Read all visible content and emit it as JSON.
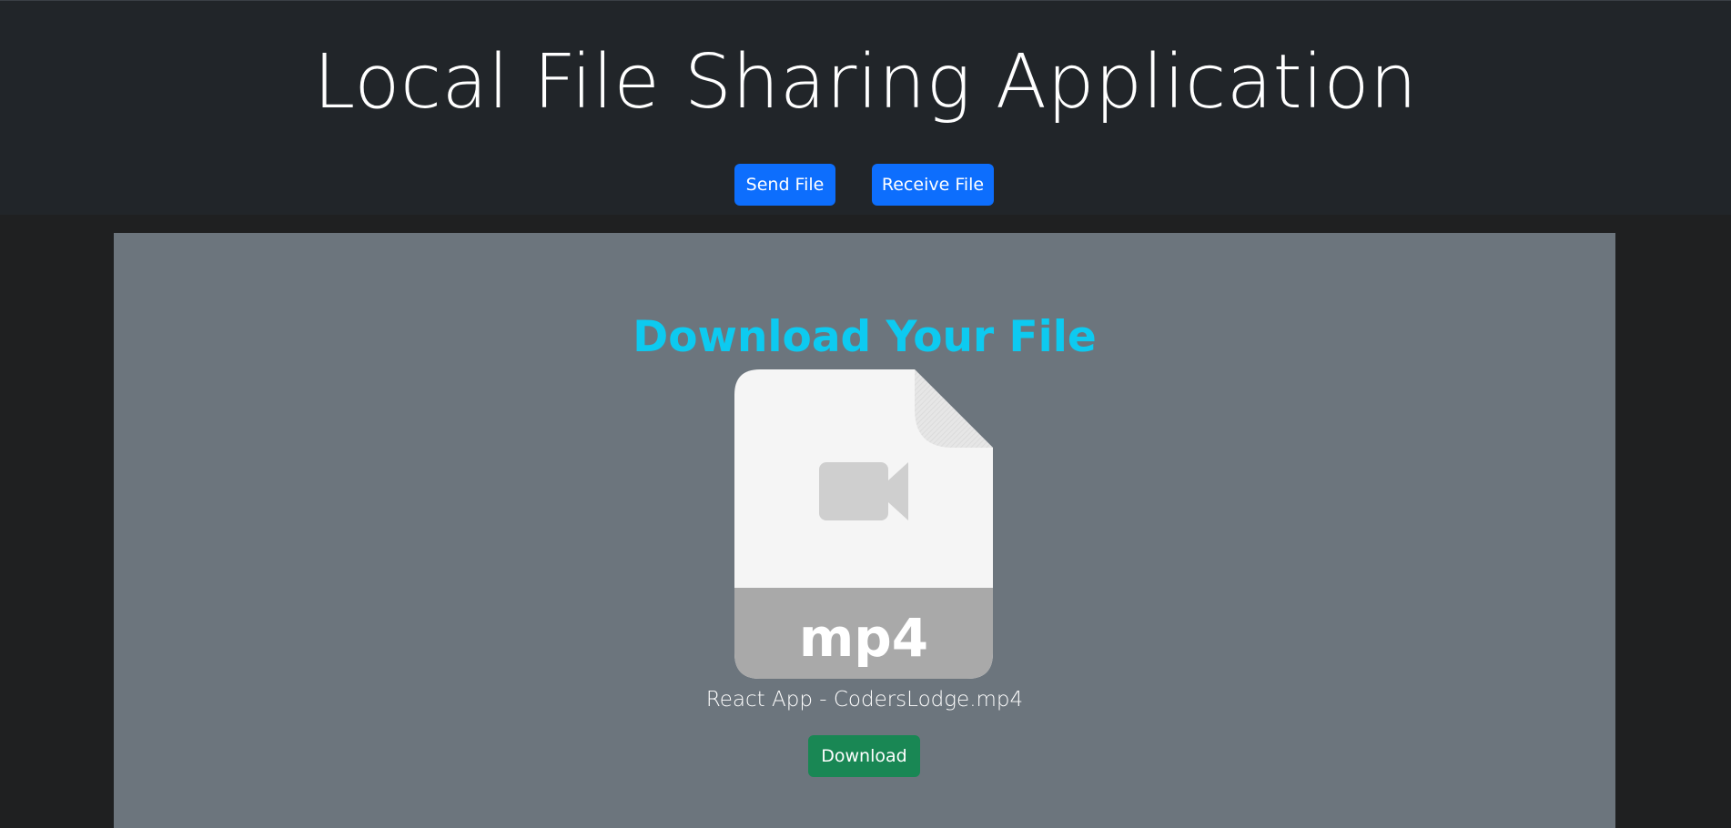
{
  "header": {
    "title": "Local File Sharing Application",
    "send_label": "Send File",
    "receive_label": "Receive File"
  },
  "main": {
    "heading": "Download Your File",
    "file": {
      "extension": "mp4",
      "name": "React App - CodersLodge.mp4",
      "icon": "video-file-icon"
    },
    "download_label": "Download"
  },
  "colors": {
    "header_bg": "#212529",
    "page_bg": "#1f2021",
    "panel_bg": "#6c757d",
    "primary": "#0d6efd",
    "success": "#198754",
    "heading": "#0dcaf0"
  }
}
